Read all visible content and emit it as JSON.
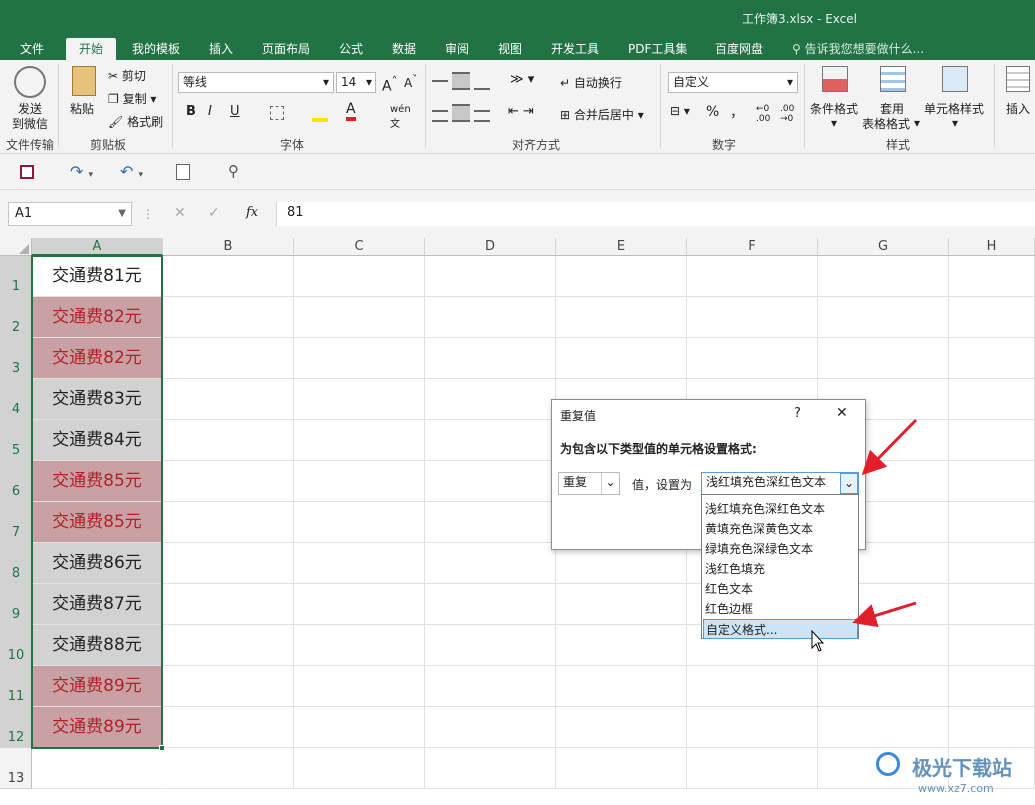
{
  "window": {
    "title": "工作簿3.xlsx - Excel"
  },
  "tabs": [
    "文件",
    "开始",
    "我的模板",
    "插入",
    "页面布局",
    "公式",
    "数据",
    "审阅",
    "视图",
    "开发工具",
    "PDF工具集",
    "百度网盘"
  ],
  "tell_me": "告诉我您想要做什么...",
  "ribbon": {
    "send": {
      "line1": "发送",
      "line2": "到微信",
      "group": "文件传输"
    },
    "clipboard": {
      "paste": "粘贴",
      "cut": "剪切",
      "copy": "复制",
      "format_painter": "格式刷",
      "group": "剪贴板"
    },
    "font": {
      "name": "等线",
      "size": "14",
      "bold": "B",
      "italic": "I",
      "underline": "U",
      "group": "字体"
    },
    "alignment": {
      "wrap": "自动换行",
      "merge": "合并后居中",
      "group": "对齐方式"
    },
    "number": {
      "format": "自定义",
      "percent": "%",
      "comma": "，",
      "group": "数字"
    },
    "styles": {
      "cond": "条件格式",
      "table1": "套用",
      "table2": "表格格式",
      "cell": "单元格样式",
      "group": "样式"
    },
    "insert": {
      "label": "插入"
    }
  },
  "formula_bar": {
    "name_box": "A1",
    "fx": "fx",
    "value": "81"
  },
  "columns": [
    "A",
    "B",
    "C",
    "D",
    "E",
    "F",
    "G",
    "H"
  ],
  "rows": [
    {
      "num": "1",
      "text": "交通费81元",
      "style": "first"
    },
    {
      "num": "2",
      "text": "交通费82元",
      "style": "dup"
    },
    {
      "num": "3",
      "text": "交通费82元",
      "style": "dup"
    },
    {
      "num": "4",
      "text": "交通费83元",
      "style": "norm"
    },
    {
      "num": "5",
      "text": "交通费84元",
      "style": "norm"
    },
    {
      "num": "6",
      "text": "交通费85元",
      "style": "dup"
    },
    {
      "num": "7",
      "text": "交通费85元",
      "style": "dup"
    },
    {
      "num": "8",
      "text": "交通费86元",
      "style": "norm"
    },
    {
      "num": "9",
      "text": "交通费87元",
      "style": "norm"
    },
    {
      "num": "10",
      "text": "交通费88元",
      "style": "norm"
    },
    {
      "num": "11",
      "text": "交通费89元",
      "style": "dup"
    },
    {
      "num": "12",
      "text": "交通费89元",
      "style": "dup"
    },
    {
      "num": "13",
      "text": "",
      "style": "empty"
    }
  ],
  "dialog": {
    "title": "重复值",
    "help": "?",
    "close": "✕",
    "prompt": "为包含以下类型值的单元格设置格式:",
    "type_value": "重复",
    "mid_label": "值，设置为",
    "format_value": "浅红填充色深红色文本",
    "options": [
      "浅红填充色深红色文本",
      "黄填充色深黄色文本",
      "绿填充色深绿色文本",
      "浅红色填充",
      "红色文本",
      "红色边框",
      "自定义格式..."
    ]
  },
  "watermark": {
    "line1": "极光下载站",
    "line2": "www.xz7.com"
  },
  "colors": {
    "excel_green": "#217346",
    "dup_fill": "#c9a0a3",
    "dup_text": "#b3202a",
    "norm_fill": "#d2d2d2",
    "arrow_red": "#e0202a"
  }
}
